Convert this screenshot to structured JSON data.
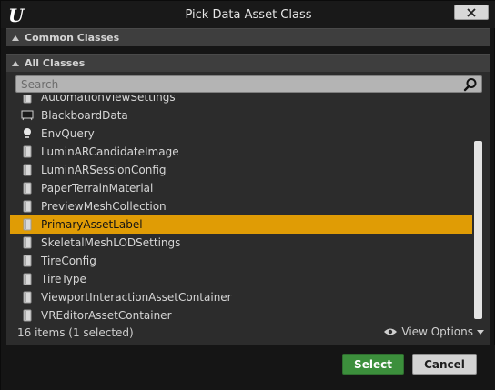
{
  "window": {
    "title": "Pick Data Asset Class",
    "logo_glyph": "U"
  },
  "sections": {
    "common": "Common Classes",
    "all": "All Classes"
  },
  "search": {
    "placeholder": "Search",
    "value": ""
  },
  "list": {
    "items": [
      {
        "label": "AutomationViewSettings",
        "icon": "data-asset-icon",
        "selected": false
      },
      {
        "label": "BlackboardData",
        "icon": "blackboard-icon",
        "selected": false
      },
      {
        "label": "EnvQuery",
        "icon": "env-query-icon",
        "selected": false
      },
      {
        "label": "LuminARCandidateImage",
        "icon": "data-asset-icon",
        "selected": false
      },
      {
        "label": "LuminARSessionConfig",
        "icon": "data-asset-icon",
        "selected": false
      },
      {
        "label": "PaperTerrainMaterial",
        "icon": "data-asset-icon",
        "selected": false
      },
      {
        "label": "PreviewMeshCollection",
        "icon": "data-asset-icon",
        "selected": false
      },
      {
        "label": "PrimaryAssetLabel",
        "icon": "data-asset-icon",
        "selected": true
      },
      {
        "label": "SkeletalMeshLODSettings",
        "icon": "data-asset-icon",
        "selected": false
      },
      {
        "label": "TireConfig",
        "icon": "data-asset-icon",
        "selected": false
      },
      {
        "label": "TireType",
        "icon": "data-asset-icon",
        "selected": false
      },
      {
        "label": "ViewportInteractionAssetContainer",
        "icon": "data-asset-icon",
        "selected": false
      },
      {
        "label": "VREditorAssetContainer",
        "icon": "data-asset-icon",
        "selected": false
      }
    ],
    "status": "16 items (1 selected)",
    "view_options": "View Options"
  },
  "buttons": {
    "select": "Select",
    "cancel": "Cancel"
  },
  "colors": {
    "selected_row": "#e09c05",
    "select_button": "#3c8f3c"
  }
}
